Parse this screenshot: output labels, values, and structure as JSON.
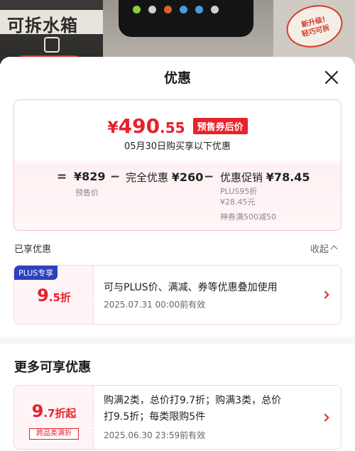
{
  "backdrop": {
    "left_banner_text": "可拆水箱",
    "right_badge_line1": "新升级!",
    "right_badge_line2": "轻巧可拆"
  },
  "sheet": {
    "title": "优惠",
    "close_icon": "close-icon"
  },
  "price_card": {
    "final_currency": "¥",
    "final_int": "490",
    "final_dec": ".55",
    "final_badge": "预售券后价",
    "date_note": "05月30日购买享以下优惠",
    "formula": {
      "eq": "=",
      "base_price": "¥829",
      "base_label": "预售价",
      "minus1": "−",
      "full_discount_label": "完全优惠",
      "full_discount_value": "¥260",
      "minus2": "−",
      "promo_label": "优惠促销",
      "promo_value": "¥78.45",
      "promo_detail1": "PLUS95折",
      "promo_detail2": "¥28.45元",
      "promo_detail3": "神券满500减50"
    }
  },
  "enjoyed": {
    "label": "已享优惠",
    "collapse_label": "收起",
    "coupon": {
      "tag": "PLUS专享",
      "discount_big": "9",
      "discount_small": ".5",
      "discount_unit": "折",
      "description": "可与PLUS价、满减、券等优惠叠加使用",
      "expire": "2025.07.31 00:00前有效"
    }
  },
  "more": {
    "title": "更多可享优惠",
    "coupon": {
      "discount_big": "9",
      "discount_small": ".7",
      "discount_unit": "折起",
      "category_tag": "跨品类满折",
      "description_line1": "购满2类，总价打9.7折；购满3类，总价",
      "description_line2": "打9.5折；每类限购5件",
      "expire": "2025.06.30 23:59前有效"
    }
  },
  "colors": {
    "accent_red": "#e8212b",
    "plus_blue": "#2f3fbf"
  }
}
